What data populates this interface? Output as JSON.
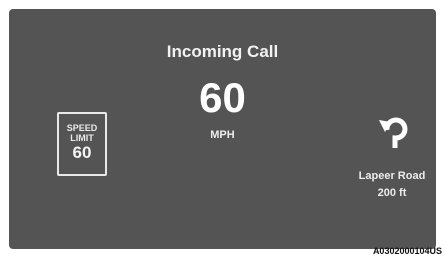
{
  "call": {
    "title": "Incoming Call"
  },
  "speed": {
    "value": "60",
    "unit": "MPH"
  },
  "speed_limit": {
    "line1": "SPEED",
    "line2": "LIMIT",
    "value": "60"
  },
  "navigation": {
    "icon": "u-turn-left-arrow-icon",
    "road": "Lapeer Road",
    "distance": "200 ft"
  },
  "figure_id": "A0302000104US",
  "colors": {
    "screen": "#545454",
    "text": "#ffffff"
  }
}
